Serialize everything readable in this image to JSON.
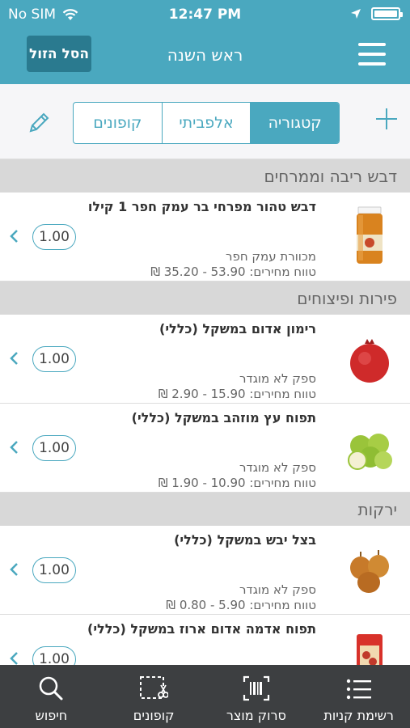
{
  "status": {
    "carrier": "No SIM",
    "time": "12:47 PM"
  },
  "nav": {
    "title": "ראש השנה",
    "cheap_button": "הסל הזול"
  },
  "segments": [
    {
      "label": "קופונים",
      "active": false
    },
    {
      "label": "אלפביתי",
      "active": false
    },
    {
      "label": "קטגוריה",
      "active": true
    }
  ],
  "sections": [
    {
      "title": "דבש ריבה וממרחים",
      "items": [
        {
          "name": "דבש טהור מפרחי בר עמק חפר 1 קילו",
          "supplier": "מכוורת עמק חפר",
          "range": "טווח מחירים: 53.90 - 35.20 ₪",
          "qty": "1.00",
          "image": "honey-jar"
        }
      ]
    },
    {
      "title": "פירות ופיצוחים",
      "items": [
        {
          "name": "רימון אדום במשקל (כללי)",
          "supplier": "ספק לא מוגדר",
          "range": "טווח מחירים: 15.90 - 2.90 ₪",
          "qty": "1.00",
          "image": "pomegranate"
        },
        {
          "name": "תפוח עץ מוזהב במשקל (כללי)",
          "supplier": "ספק לא מוגדר",
          "range": "טווח מחירים: 10.90 - 1.90 ₪",
          "qty": "1.00",
          "image": "green-apples"
        }
      ]
    },
    {
      "title": "ירקות",
      "items": [
        {
          "name": "בצל יבש במשקל (כללי)",
          "supplier": "ספק לא מוגדר",
          "range": "טווח מחירים: 5.90 - 0.80 ₪",
          "qty": "1.00",
          "image": "onions"
        },
        {
          "name": "תפוח אדמה אדום ארוז במשקל (כללי)",
          "supplier": "",
          "range": "",
          "qty": "1.00",
          "image": "potato-bag"
        }
      ]
    }
  ],
  "tabs": [
    {
      "label": "חיפוש",
      "icon": "search-icon"
    },
    {
      "label": "קופונים",
      "icon": "coupon-scissors-icon"
    },
    {
      "label": "סרוק מוצר",
      "icon": "barcode-scan-icon"
    },
    {
      "label": "רשימת קניות",
      "icon": "list-icon"
    }
  ],
  "colors": {
    "accent": "#4aa8bf",
    "accent_dark": "#2a7a8f",
    "tabbar": "#3d3f41",
    "section_bg": "#d8d8d8"
  }
}
